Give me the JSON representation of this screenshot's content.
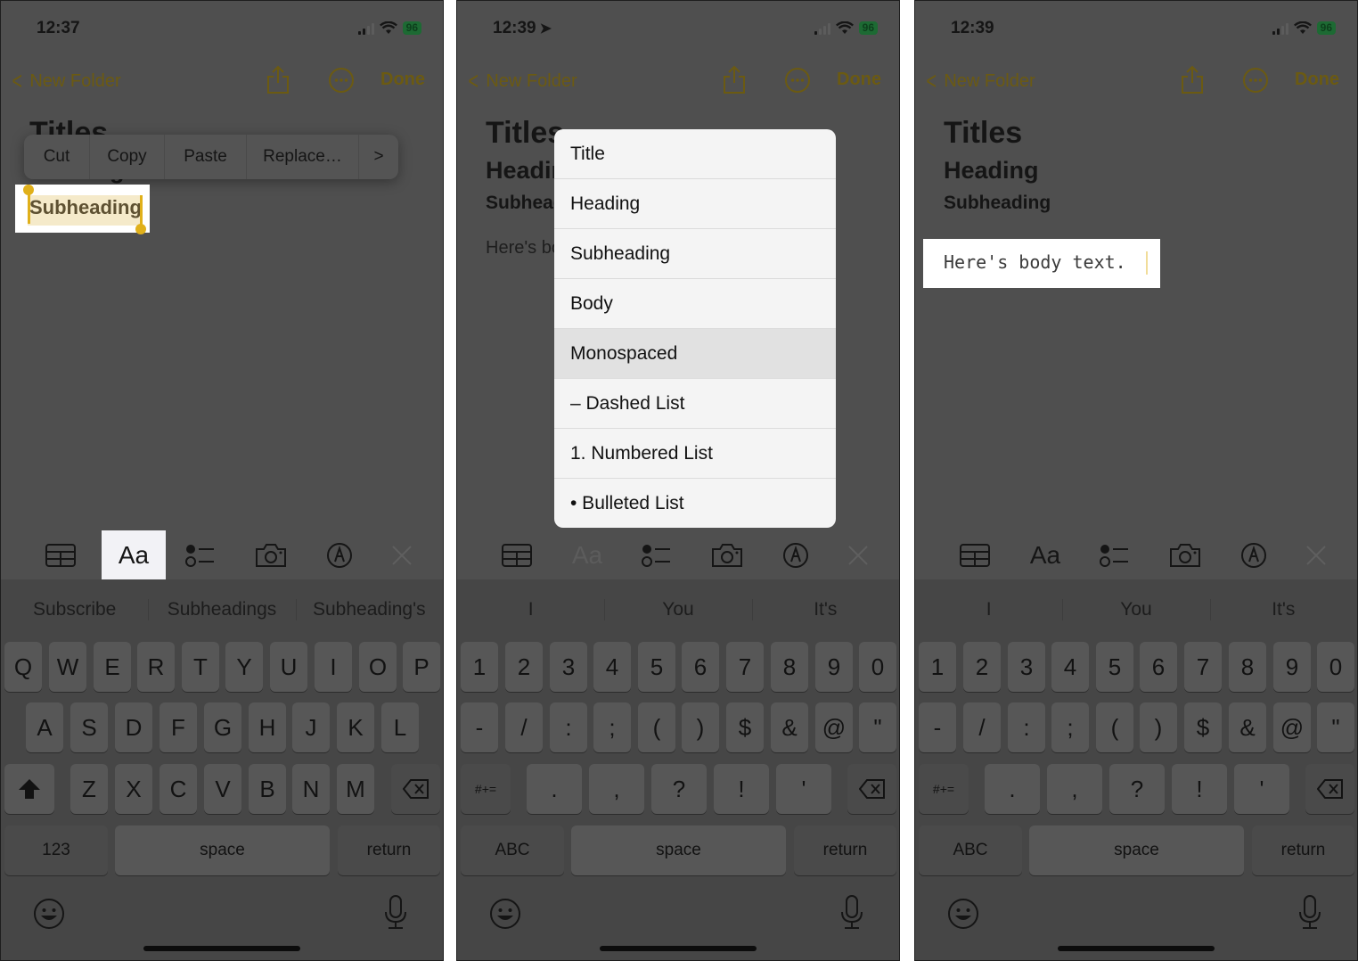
{
  "accent_color": "#6b5a12",
  "battery_color": "#1d6a33",
  "panels": [
    {
      "status": {
        "time": "12:37",
        "battery": "96"
      },
      "nav": {
        "back_label": "New Folder",
        "done_label": "Done"
      },
      "note": {
        "title": "Titles",
        "heading": "Heading",
        "subheading": "Subheading"
      },
      "edit_menu": [
        "Cut",
        "Copy",
        "Paste",
        "Replace…"
      ],
      "selected_text": "Subheading",
      "toolbar": {
        "format_label": "Aa",
        "format_state": "active"
      },
      "suggestions": [
        "Subscribe",
        "Subheadings",
        "Subheading's"
      ],
      "keyboard": {
        "row1": [
          "Q",
          "W",
          "E",
          "R",
          "T",
          "Y",
          "U",
          "I",
          "O",
          "P"
        ],
        "row2": [
          "A",
          "S",
          "D",
          "F",
          "G",
          "H",
          "J",
          "K",
          "L"
        ],
        "row3": [
          "Z",
          "X",
          "C",
          "V",
          "B",
          "N",
          "M"
        ],
        "mode_key": "123",
        "space": "space",
        "return": "return"
      }
    },
    {
      "status": {
        "time": "12:39",
        "battery": "96"
      },
      "nav": {
        "back_label": "New Folder",
        "done_label": "Done"
      },
      "note": {
        "title": "Titles",
        "heading": "Heading",
        "subheading": "Subheading",
        "body": "Here's body text."
      },
      "style_menu": {
        "options": [
          "Title",
          "Heading",
          "Subheading",
          "Body",
          "Monospaced",
          "– Dashed List",
          "1. Numbered List",
          "• Bulleted List"
        ],
        "selected": "Monospaced"
      },
      "toolbar": {
        "format_label": "Aa",
        "format_state": "disabled"
      },
      "suggestions": [
        "I",
        "You",
        "It's"
      ],
      "keyboard": {
        "row1": [
          "1",
          "2",
          "3",
          "4",
          "5",
          "6",
          "7",
          "8",
          "9",
          "0"
        ],
        "row2": [
          "-",
          "/",
          ":",
          ";",
          "(",
          ")",
          "$",
          "&",
          "@",
          "\""
        ],
        "row3": [
          ".",
          ",",
          "?",
          "!",
          "'"
        ],
        "shift_key": "#+=",
        "mode_key": "ABC",
        "space": "space",
        "return": "return"
      }
    },
    {
      "status": {
        "time": "12:39",
        "battery": "96"
      },
      "nav": {
        "back_label": "New Folder",
        "done_label": "Done"
      },
      "note": {
        "title": "Titles",
        "heading": "Heading",
        "subheading": "Subheading",
        "body": "Here's body text."
      },
      "toolbar": {
        "format_label": "Aa",
        "format_state": "normal"
      },
      "suggestions": [
        "I",
        "You",
        "It's"
      ],
      "keyboard": {
        "row1": [
          "1",
          "2",
          "3",
          "4",
          "5",
          "6",
          "7",
          "8",
          "9",
          "0"
        ],
        "row2": [
          "-",
          "/",
          ":",
          ";",
          "(",
          ")",
          "$",
          "&",
          "@",
          "\""
        ],
        "row3": [
          ".",
          ",",
          "?",
          "!",
          "'"
        ],
        "shift_key": "#+=",
        "mode_key": "ABC",
        "space": "space",
        "return": "return"
      }
    }
  ]
}
